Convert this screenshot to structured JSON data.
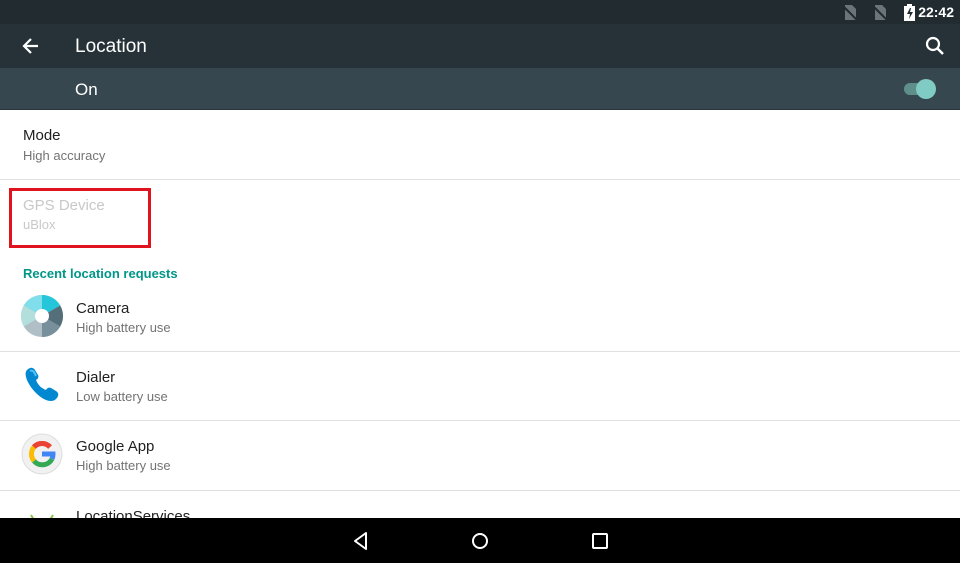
{
  "status_bar": {
    "time": "22:42",
    "icons": [
      "no-sim-icon",
      "no-sim-icon",
      "battery-charging-icon"
    ]
  },
  "toolbar": {
    "title": "Location",
    "back_icon": "arrow-back-icon",
    "search_icon": "search-icon"
  },
  "master_switch": {
    "label": "On",
    "checked": true
  },
  "preferences": [
    {
      "title": "Mode",
      "summary": "High accuracy",
      "enabled": true
    },
    {
      "title": "GPS Device",
      "summary": "uBlox",
      "enabled": false,
      "highlighted": true
    }
  ],
  "recent_section": {
    "title": "Recent location requests",
    "apps": [
      {
        "name": "Camera",
        "summary": "High battery use",
        "icon": "camera-icon"
      },
      {
        "name": "Dialer",
        "summary": "Low battery use",
        "icon": "phone-icon"
      },
      {
        "name": "Google App",
        "summary": "High battery use",
        "icon": "google-icon"
      },
      {
        "name": "LocationServices",
        "summary": "",
        "icon": "android-icon"
      }
    ]
  },
  "nav_bar": {
    "back": "nav-back-icon",
    "home": "nav-home-icon",
    "recents": "nav-recents-icon"
  },
  "colors": {
    "status_bar": "#212b30",
    "toolbar": "#263238",
    "switch_bar": "#37474f",
    "accent": "#009688",
    "toggle_thumb": "#80cbc4",
    "highlight_border": "#e0141e"
  }
}
